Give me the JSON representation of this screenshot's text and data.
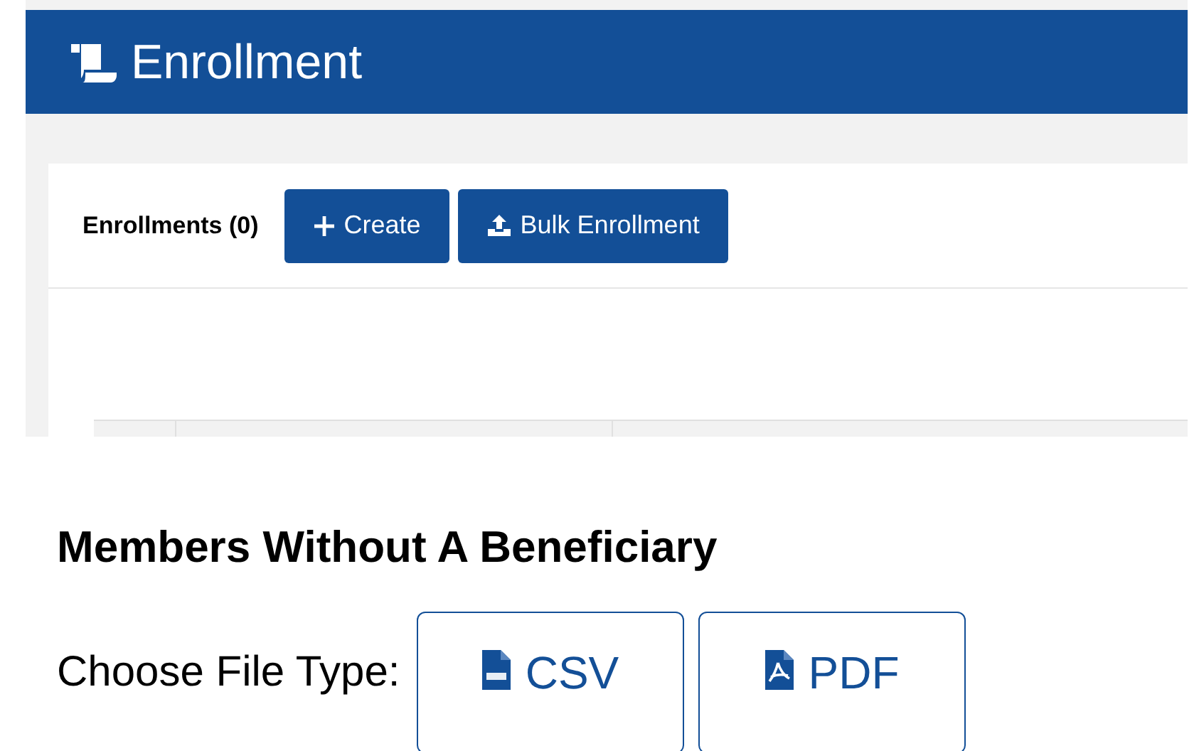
{
  "header": {
    "title": "Enrollment"
  },
  "toolbar": {
    "title": "Enrollments (0)",
    "buttons": [
      {
        "label": "Create",
        "kind": "create"
      },
      {
        "label": "Bulk Enrollment",
        "kind": "upload"
      }
    ]
  },
  "report": {
    "title": "Members Without A Beneficiary",
    "label": "Choose File Type:",
    "buttons": [
      {
        "label": "CSV",
        "kind": "csv"
      },
      {
        "label": "PDF",
        "kind": "pdf"
      }
    ]
  }
}
